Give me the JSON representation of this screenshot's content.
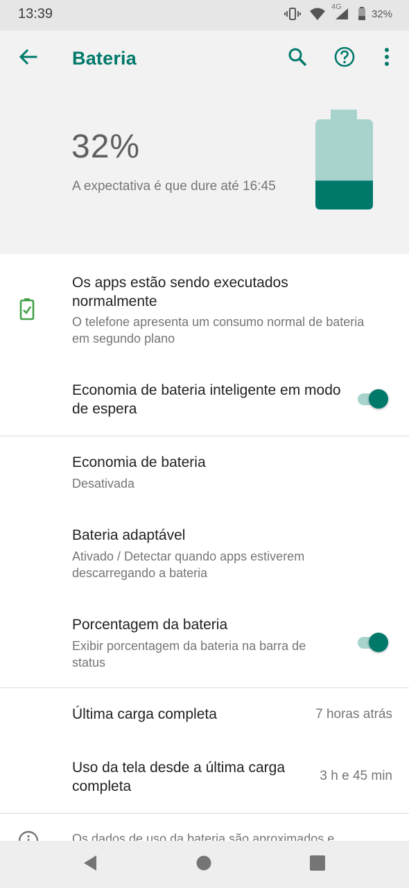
{
  "status_bar": {
    "time": "13:39",
    "network": "4G",
    "battery_percent": "32%",
    "icons": [
      "vibrate-icon",
      "wifi-icon",
      "signal-icon",
      "battery-icon"
    ]
  },
  "app_bar": {
    "title": "Bateria",
    "actions": [
      "back-arrow-icon",
      "search-icon",
      "help-icon",
      "more-vert-icon"
    ]
  },
  "header": {
    "percent": "32%",
    "estimate": "A expectativa é que dure até 16:45",
    "battery_level": 0.32
  },
  "apps_status": {
    "title": "Os apps estão sendo executados normalmente",
    "subtitle": "O telefone apresenta um consumo normal de bateria em segundo plano",
    "icon": "battery-check-icon"
  },
  "smart_standby": {
    "title": "Economia de bateria inteligente em modo de espera",
    "enabled": true
  },
  "battery_saver": {
    "title": "Economia de bateria",
    "subtitle": "Desativada"
  },
  "adaptive_battery": {
    "title": "Bateria adaptável",
    "subtitle": "Ativado / Detectar quando apps estiverem descarregando a bateria"
  },
  "battery_percentage": {
    "title": "Porcentagem da bateria",
    "subtitle": "Exibir porcentagem da bateria na barra de status",
    "enabled": true
  },
  "last_full_charge": {
    "title": "Última carga completa",
    "value": "7 horas atrás"
  },
  "screen_usage": {
    "title": "Uso da tela desde a última carga completa",
    "value": "3 h e 45 min"
  },
  "footer_note": {
    "text": "Os dados de uso da bateria são aproximados e",
    "icon": "info-icon"
  },
  "nav_bar": {
    "buttons": [
      "back-nav-icon",
      "home-nav-icon",
      "recents-nav-icon"
    ]
  },
  "colors": {
    "accent": "#00796b",
    "accent_light": "#a8d3cd",
    "header_bg": "#f2f2f2",
    "ok_green": "#43a047"
  }
}
